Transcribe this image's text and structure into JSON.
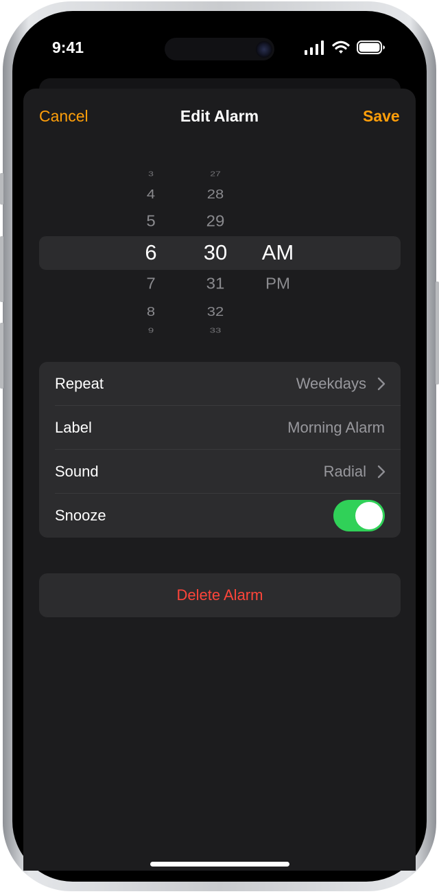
{
  "status": {
    "time": "9:41"
  },
  "nav": {
    "cancel": "Cancel",
    "title": "Edit Alarm",
    "save": "Save"
  },
  "picker": {
    "hours": [
      "3",
      "4",
      "5",
      "6",
      "7",
      "8",
      "9"
    ],
    "minutes": [
      "27",
      "28",
      "29",
      "30",
      "31",
      "32",
      "33"
    ],
    "periods": [
      "AM",
      "PM"
    ],
    "selected": {
      "hour": "6",
      "minute": "30",
      "period": "AM"
    }
  },
  "settings": {
    "repeat": {
      "label": "Repeat",
      "value": "Weekdays"
    },
    "label": {
      "label": "Label",
      "value": "Morning Alarm"
    },
    "sound": {
      "label": "Sound",
      "value": "Radial"
    },
    "snooze": {
      "label": "Snooze",
      "on": true
    }
  },
  "delete_label": "Delete Alarm",
  "colors": {
    "accent": "#ff9f0a",
    "toggle_on": "#30d158",
    "destructive": "#ff453a",
    "background": "#1c1c1e",
    "cell": "#2c2c2e"
  }
}
